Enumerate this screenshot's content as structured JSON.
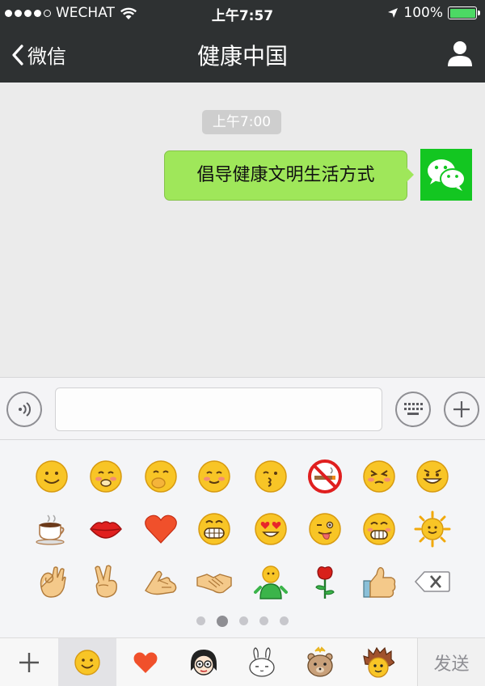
{
  "status_bar": {
    "carrier": "WECHAT",
    "time": "上午7:57",
    "battery_percent": "100%",
    "battery_level": 1.0
  },
  "nav": {
    "back_label": "微信",
    "title": "健康中国"
  },
  "chat": {
    "timestamp": "上午7:00",
    "messages": [
      {
        "sender": "self",
        "text": "倡导健康文明生活方式"
      }
    ]
  },
  "input": {
    "value": "",
    "placeholder": ""
  },
  "emoji_panel": {
    "rows": [
      [
        "smile-emoji",
        "blush-emoji",
        "giggle-emoji",
        "shy-smile-emoji",
        "kiss-emoji",
        "no-smoking-emoji",
        "dizzy-emoji",
        "grin-emoji"
      ],
      [
        "coffee-emoji",
        "lips-emoji",
        "heart-emoji",
        "toothy-grin-emoji",
        "heart-eyes-emoji",
        "tongue-out-emoji",
        "grimace-emoji",
        "sun-emoji"
      ],
      [
        "ok-hand-emoji",
        "victory-hand-emoji",
        "fist-bump-emoji",
        "handshake-emoji",
        "doll-emoji",
        "rose-emoji",
        "thumbs-up-emoji",
        "delete-key"
      ]
    ],
    "page_count": 5,
    "current_page": 2
  },
  "tab_bar": {
    "tabs": [
      "plus",
      "smiley",
      "heart",
      "sticker-girl",
      "sticker-bunny",
      "sticker-bear",
      "sticker-hedgehog"
    ],
    "selected_tab": 1,
    "send_label": "发送"
  },
  "colors": {
    "header_bg": "#2e3132",
    "bubble_green": "#9fe75a",
    "avatar_green": "#13c621",
    "chat_bg": "#ebebeb"
  }
}
